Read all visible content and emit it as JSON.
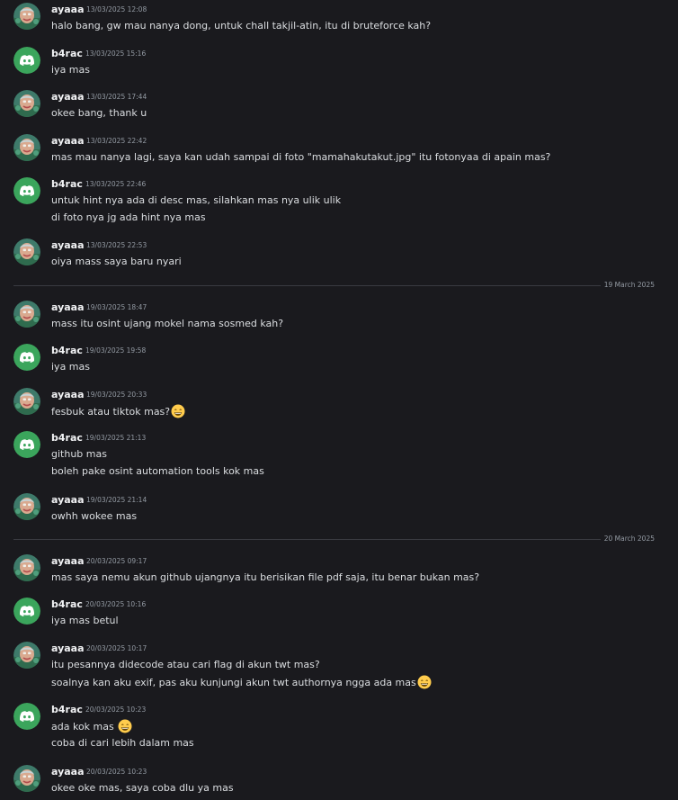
{
  "icons": {
    "ayaaa_avatar": "photo-avatar-icon",
    "b4rac_avatar": "discord-logo-icon",
    "emoji": "grinning-face-emoji-icon"
  },
  "colors": {
    "background": "#1a1a1e",
    "discord_avatar": "#3ba55c",
    "text": "#dbdee1",
    "muted": "#949ba4"
  },
  "dividers": [
    {
      "label": "19 March 2025"
    },
    {
      "label": "20 March 2025"
    }
  ],
  "messages": [
    {
      "author": "ayaaa",
      "timestamp": "13/03/2025 12:08",
      "lines": [
        {
          "text": "halo bang, gw mau nanya dong, untuk chall takjil-atin, itu di bruteforce kah?"
        }
      ]
    },
    {
      "author": "b4rac",
      "timestamp": "13/03/2025 15:16",
      "lines": [
        {
          "text": "iya mas"
        }
      ]
    },
    {
      "author": "ayaaa",
      "timestamp": "13/03/2025 17:44",
      "lines": [
        {
          "text": "okee bang, thank u"
        }
      ]
    },
    {
      "author": "ayaaa",
      "timestamp": "13/03/2025 22:42",
      "lines": [
        {
          "text": "mas mau nanya lagi, saya kan udah sampai di foto \"mamahakutakut.jpg\" itu fotonyaa di apain mas?"
        }
      ]
    },
    {
      "author": "b4rac",
      "timestamp": "13/03/2025 22:46",
      "lines": [
        {
          "text": "untuk hint nya ada di desc mas, silahkan mas nya ulik ulik"
        },
        {
          "text": "di foto nya jg ada hint nya mas"
        }
      ]
    },
    {
      "author": "ayaaa",
      "timestamp": "13/03/2025 22:53",
      "lines": [
        {
          "text": "oiya mass saya baru nyari"
        }
      ]
    },
    {
      "author": "ayaaa",
      "timestamp": "19/03/2025 18:47",
      "lines": [
        {
          "text": "mass itu osint ujang mokel nama sosmed kah?"
        }
      ]
    },
    {
      "author": "b4rac",
      "timestamp": "19/03/2025 19:58",
      "lines": [
        {
          "text": "iya mas"
        }
      ]
    },
    {
      "author": "ayaaa",
      "timestamp": "19/03/2025 20:33",
      "lines": [
        {
          "text": "fesbuk atau tiktok mas?",
          "emoji": true
        }
      ]
    },
    {
      "author": "b4rac",
      "timestamp": "19/03/2025 21:13",
      "lines": [
        {
          "text": "github mas"
        },
        {
          "text": "boleh pake osint automation tools kok mas"
        }
      ]
    },
    {
      "author": "ayaaa",
      "timestamp": "19/03/2025 21:14",
      "lines": [
        {
          "text": "owhh wokee mas"
        }
      ]
    },
    {
      "author": "ayaaa",
      "timestamp": "20/03/2025 09:17",
      "lines": [
        {
          "text": "mas saya nemu akun github ujangnya itu berisikan file pdf saja, itu benar bukan mas?"
        }
      ]
    },
    {
      "author": "b4rac",
      "timestamp": "20/03/2025 10:16",
      "lines": [
        {
          "text": "iya mas betul"
        }
      ]
    },
    {
      "author": "ayaaa",
      "timestamp": "20/03/2025 10:17",
      "lines": [
        {
          "text": "itu pesannya didecode atau cari flag di akun twt mas?"
        },
        {
          "text": "soalnya kan aku exif, pas aku kunjungi akun twt authornya ngga ada mas",
          "emoji": true
        }
      ]
    },
    {
      "author": "b4rac",
      "timestamp": "20/03/2025 10:23",
      "lines": [
        {
          "text": "ada kok mas ",
          "emoji": true
        },
        {
          "text": "coba di cari lebih dalam mas"
        }
      ]
    },
    {
      "author": "ayaaa",
      "timestamp": "20/03/2025 10:23",
      "lines": [
        {
          "text": "okee oke mas, saya coba dlu ya mas"
        }
      ]
    }
  ]
}
